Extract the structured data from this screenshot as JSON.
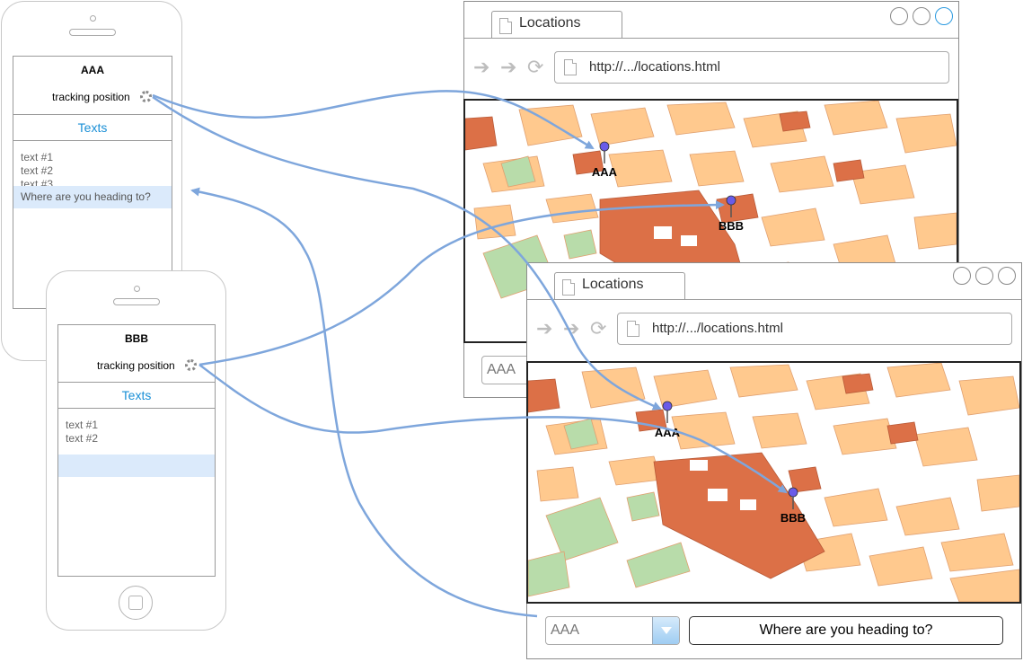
{
  "phones": [
    {
      "user": "AAA",
      "tracking_label": "tracking position",
      "tab_label": "Texts",
      "messages": [
        "text #1",
        "text #2",
        "text #3"
      ],
      "highlight_text": "Where are you heading to?"
    },
    {
      "user": "BBB",
      "tracking_label": "tracking position",
      "tab_label": "Texts",
      "messages": [
        "text #1",
        "text #2"
      ],
      "highlight_text": ""
    }
  ],
  "browsers": [
    {
      "tab_title": "Locations",
      "url": "http://.../locations.html",
      "markers": [
        "AAA",
        "BBB"
      ],
      "user_select": "AAA"
    },
    {
      "tab_title": "Locations",
      "url": "http://.../locations.html",
      "markers": [
        "AAA",
        "BBB"
      ],
      "user_select": "AAA",
      "message_field": "Where are you heading to?"
    }
  ],
  "colors": {
    "connector": "#7ea6dc",
    "link_blue": "#1a8fd6",
    "map_block": "#ffc98e",
    "map_park": "#b8dcaa",
    "map_highlight": "#dc7047",
    "highlight_row": "#dbeafb"
  },
  "icons": [
    "page-icon",
    "back-arrow-icon",
    "forward-arrow-icon",
    "reload-icon",
    "dropdown-arrow-icon",
    "map-pin-icon",
    "loading-spinner-icon"
  ]
}
